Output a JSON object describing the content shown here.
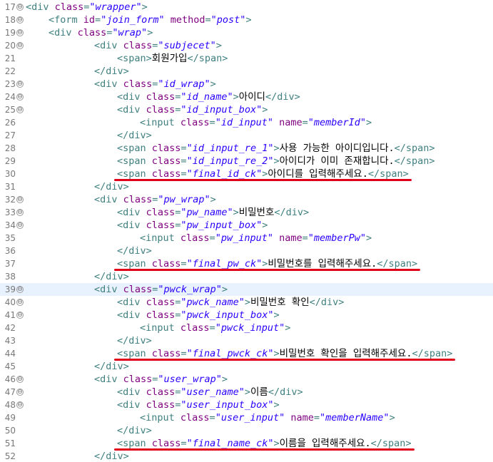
{
  "editor": {
    "lines": [
      {
        "ln": "17",
        "fold": true,
        "indent": 0,
        "seg": [
          [
            "t",
            "<div "
          ],
          [
            "a",
            "class"
          ],
          [
            "t",
            "="
          ],
          [
            "v",
            "\"wrapper\""
          ],
          [
            "t",
            ">"
          ]
        ]
      },
      {
        "ln": "18",
        "fold": true,
        "indent": 1,
        "seg": [
          [
            "t",
            "<form "
          ],
          [
            "a",
            "id"
          ],
          [
            "t",
            "="
          ],
          [
            "v",
            "\"join_form\""
          ],
          [
            "t",
            " "
          ],
          [
            "a",
            "method"
          ],
          [
            "t",
            "="
          ],
          [
            "v",
            "\"post\""
          ],
          [
            "t",
            ">"
          ]
        ]
      },
      {
        "ln": "19",
        "fold": true,
        "indent": 1,
        "seg": [
          [
            "t",
            "<div "
          ],
          [
            "a",
            "class"
          ],
          [
            "t",
            "="
          ],
          [
            "v",
            "\"wrap\""
          ],
          [
            "t",
            ">"
          ]
        ]
      },
      {
        "ln": "20",
        "fold": true,
        "indent": 3,
        "seg": [
          [
            "t",
            "<div "
          ],
          [
            "a",
            "class"
          ],
          [
            "t",
            "="
          ],
          [
            "v",
            "\"subjecet\""
          ],
          [
            "t",
            ">"
          ]
        ]
      },
      {
        "ln": "21",
        "fold": false,
        "indent": 4,
        "seg": [
          [
            "t",
            "<span>"
          ],
          [
            "x",
            "회원가입"
          ],
          [
            "t",
            "</span>"
          ]
        ]
      },
      {
        "ln": "22",
        "fold": false,
        "indent": 3,
        "seg": [
          [
            "t",
            "</div>"
          ]
        ]
      },
      {
        "ln": "23",
        "fold": true,
        "indent": 3,
        "seg": [
          [
            "t",
            "<div "
          ],
          [
            "a",
            "class"
          ],
          [
            "t",
            "="
          ],
          [
            "v",
            "\"id_wrap\""
          ],
          [
            "t",
            ">"
          ]
        ]
      },
      {
        "ln": "24",
        "fold": true,
        "indent": 4,
        "seg": [
          [
            "t",
            "<div "
          ],
          [
            "a",
            "class"
          ],
          [
            "t",
            "="
          ],
          [
            "v",
            "\"id_name\""
          ],
          [
            "t",
            ">"
          ],
          [
            "x",
            "아이디"
          ],
          [
            "t",
            "</div>"
          ]
        ]
      },
      {
        "ln": "25",
        "fold": true,
        "indent": 4,
        "seg": [
          [
            "t",
            "<div "
          ],
          [
            "a",
            "class"
          ],
          [
            "t",
            "="
          ],
          [
            "v",
            "\"id_input_box\""
          ],
          [
            "t",
            ">"
          ]
        ]
      },
      {
        "ln": "26",
        "fold": false,
        "indent": 5,
        "seg": [
          [
            "t",
            "<input "
          ],
          [
            "a",
            "class"
          ],
          [
            "t",
            "="
          ],
          [
            "v",
            "\"id_input\""
          ],
          [
            "t",
            " "
          ],
          [
            "a",
            "name"
          ],
          [
            "t",
            "="
          ],
          [
            "v",
            "\"memberId\""
          ],
          [
            "t",
            ">"
          ]
        ]
      },
      {
        "ln": "27",
        "fold": false,
        "indent": 4,
        "seg": [
          [
            "t",
            "</div>"
          ]
        ]
      },
      {
        "ln": "28",
        "fold": false,
        "indent": 4,
        "seg": [
          [
            "t",
            "<span "
          ],
          [
            "a",
            "class"
          ],
          [
            "t",
            "="
          ],
          [
            "v",
            "\"id_input_re_1\""
          ],
          [
            "t",
            ">"
          ],
          [
            "x",
            "사용 가능한 아이디입니다."
          ],
          [
            "t",
            "</span>"
          ]
        ]
      },
      {
        "ln": "29",
        "fold": false,
        "indent": 4,
        "seg": [
          [
            "t",
            "<span "
          ],
          [
            "a",
            "class"
          ],
          [
            "t",
            "="
          ],
          [
            "v",
            "\"id_input_re_2\""
          ],
          [
            "t",
            ">"
          ],
          [
            "x",
            "아이디가 이미 존재합니다."
          ],
          [
            "t",
            "</span>"
          ]
        ]
      },
      {
        "ln": "30",
        "fold": false,
        "indent": 4,
        "seg": [
          [
            "t",
            "<span "
          ],
          [
            "a",
            "class"
          ],
          [
            "t",
            "="
          ],
          [
            "v",
            "\"final_id_ck\""
          ],
          [
            "t",
            ">"
          ],
          [
            "x",
            "아이디를 입력해주세요."
          ],
          [
            "t",
            "</span>"
          ]
        ]
      },
      {
        "ln": "31",
        "fold": false,
        "indent": 3,
        "seg": [
          [
            "t",
            "</div>"
          ]
        ]
      },
      {
        "ln": "32",
        "fold": true,
        "indent": 3,
        "seg": [
          [
            "t",
            "<div "
          ],
          [
            "a",
            "class"
          ],
          [
            "t",
            "="
          ],
          [
            "v",
            "\"pw_wrap\""
          ],
          [
            "t",
            ">"
          ]
        ]
      },
      {
        "ln": "33",
        "fold": true,
        "indent": 4,
        "seg": [
          [
            "t",
            "<div "
          ],
          [
            "a",
            "class"
          ],
          [
            "t",
            "="
          ],
          [
            "v",
            "\"pw_name\""
          ],
          [
            "t",
            ">"
          ],
          [
            "x",
            "비밀번호"
          ],
          [
            "t",
            "</div>"
          ]
        ]
      },
      {
        "ln": "34",
        "fold": true,
        "indent": 4,
        "seg": [
          [
            "t",
            "<div "
          ],
          [
            "a",
            "class"
          ],
          [
            "t",
            "="
          ],
          [
            "v",
            "\"pw_input_box\""
          ],
          [
            "t",
            ">"
          ]
        ]
      },
      {
        "ln": "35",
        "fold": false,
        "indent": 5,
        "seg": [
          [
            "t",
            "<input "
          ],
          [
            "a",
            "class"
          ],
          [
            "t",
            "="
          ],
          [
            "v",
            "\"pw_input\""
          ],
          [
            "t",
            " "
          ],
          [
            "a",
            "name"
          ],
          [
            "t",
            "="
          ],
          [
            "v",
            "\"memberPw\""
          ],
          [
            "t",
            ">"
          ]
        ]
      },
      {
        "ln": "36",
        "fold": false,
        "indent": 4,
        "seg": [
          [
            "t",
            "</div>"
          ]
        ]
      },
      {
        "ln": "37",
        "fold": false,
        "indent": 4,
        "seg": [
          [
            "t",
            "<span "
          ],
          [
            "a",
            "class"
          ],
          [
            "t",
            "="
          ],
          [
            "v",
            "\"final_pw_ck\""
          ],
          [
            "t",
            ">"
          ],
          [
            "x",
            "비밀번호를 입력해주세요."
          ],
          [
            "t",
            "</span>"
          ]
        ]
      },
      {
        "ln": "38",
        "fold": false,
        "indent": 3,
        "seg": [
          [
            "t",
            "</div>"
          ]
        ]
      },
      {
        "ln": "39",
        "fold": true,
        "indent": 3,
        "current": true,
        "seg": [
          [
            "t",
            "<div "
          ],
          [
            "a",
            "class"
          ],
          [
            "t",
            "="
          ],
          [
            "v",
            "\"pwck_wrap\""
          ],
          [
            "t",
            ">"
          ]
        ]
      },
      {
        "ln": "40",
        "fold": true,
        "indent": 4,
        "seg": [
          [
            "t",
            "<div "
          ],
          [
            "a",
            "class"
          ],
          [
            "t",
            "="
          ],
          [
            "v",
            "\"pwck_name\""
          ],
          [
            "t",
            ">"
          ],
          [
            "x",
            "비밀번호 확인"
          ],
          [
            "t",
            "</div>"
          ]
        ]
      },
      {
        "ln": "41",
        "fold": true,
        "indent": 4,
        "seg": [
          [
            "t",
            "<div "
          ],
          [
            "a",
            "class"
          ],
          [
            "t",
            "="
          ],
          [
            "v",
            "\"pwck_input_box\""
          ],
          [
            "t",
            ">"
          ]
        ]
      },
      {
        "ln": "42",
        "fold": false,
        "indent": 5,
        "seg": [
          [
            "t",
            "<input "
          ],
          [
            "a",
            "class"
          ],
          [
            "t",
            "="
          ],
          [
            "v",
            "\"pwck_input\""
          ],
          [
            "t",
            ">"
          ]
        ]
      },
      {
        "ln": "43",
        "fold": false,
        "indent": 4,
        "seg": [
          [
            "t",
            "</div>"
          ]
        ]
      },
      {
        "ln": "44",
        "fold": false,
        "indent": 4,
        "seg": [
          [
            "t",
            "<span "
          ],
          [
            "a",
            "class"
          ],
          [
            "t",
            "="
          ],
          [
            "v",
            "\"final_pwck_ck\""
          ],
          [
            "t",
            ">"
          ],
          [
            "x",
            "비밀번호 확인을 입력해주세요."
          ],
          [
            "t",
            "</span>"
          ]
        ]
      },
      {
        "ln": "45",
        "fold": false,
        "indent": 3,
        "seg": [
          [
            "t",
            "</div>"
          ]
        ]
      },
      {
        "ln": "46",
        "fold": true,
        "indent": 3,
        "seg": [
          [
            "t",
            "<div "
          ],
          [
            "a",
            "class"
          ],
          [
            "t",
            "="
          ],
          [
            "v",
            "\"user_wrap\""
          ],
          [
            "t",
            ">"
          ]
        ]
      },
      {
        "ln": "47",
        "fold": true,
        "indent": 4,
        "seg": [
          [
            "t",
            "<div "
          ],
          [
            "a",
            "class"
          ],
          [
            "t",
            "="
          ],
          [
            "v",
            "\"user_name\""
          ],
          [
            "t",
            ">"
          ],
          [
            "x",
            "이름"
          ],
          [
            "t",
            "</div>"
          ]
        ]
      },
      {
        "ln": "48",
        "fold": true,
        "indent": 4,
        "seg": [
          [
            "t",
            "<div "
          ],
          [
            "a",
            "class"
          ],
          [
            "t",
            "="
          ],
          [
            "v",
            "\"user_input_box\""
          ],
          [
            "t",
            ">"
          ]
        ]
      },
      {
        "ln": "49",
        "fold": false,
        "indent": 5,
        "seg": [
          [
            "t",
            "<input "
          ],
          [
            "a",
            "class"
          ],
          [
            "t",
            "="
          ],
          [
            "v",
            "\"user_input\""
          ],
          [
            "t",
            " "
          ],
          [
            "a",
            "name"
          ],
          [
            "t",
            "="
          ],
          [
            "v",
            "\"memberName\""
          ],
          [
            "t",
            ">"
          ]
        ]
      },
      {
        "ln": "50",
        "fold": false,
        "indent": 4,
        "seg": [
          [
            "t",
            "</div>"
          ]
        ]
      },
      {
        "ln": "51",
        "fold": false,
        "indent": 4,
        "seg": [
          [
            "t",
            "<span "
          ],
          [
            "a",
            "class"
          ],
          [
            "t",
            "="
          ],
          [
            "v",
            "\"final_name_ck\""
          ],
          [
            "t",
            ">"
          ],
          [
            "x",
            "이름을 입력해주세요."
          ],
          [
            "t",
            "</span>"
          ]
        ]
      },
      {
        "ln": "52",
        "fold": false,
        "indent": 3,
        "seg": [
          [
            "t",
            "</div>"
          ]
        ]
      }
    ],
    "fold_glyph": "⊖",
    "underlined_lines": [
      "30",
      "37",
      "44",
      "51"
    ],
    "colors": {
      "tag": "#3f7f7f",
      "attribute": "#7f007f",
      "value": "#2a00ff",
      "text": "#000000",
      "line_number": "#787878",
      "current_line": "#e8f2fe",
      "annotation_underline": "#e0001a"
    }
  }
}
